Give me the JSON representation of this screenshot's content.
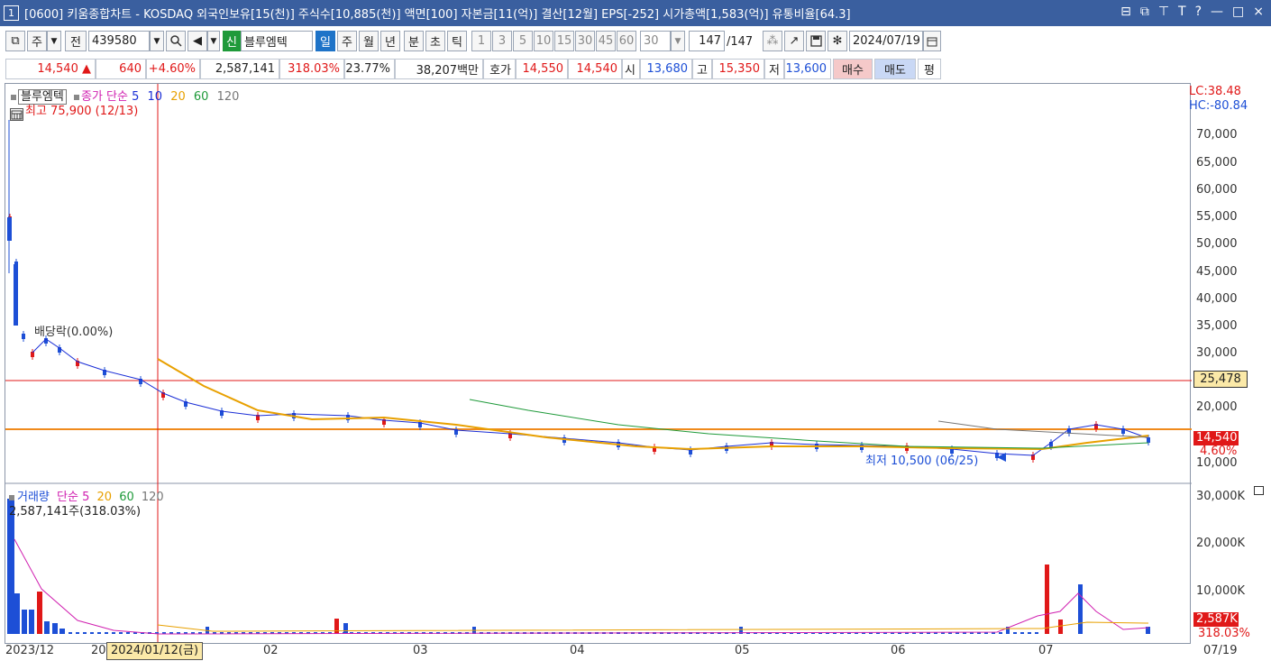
{
  "title_bar": {
    "window_number": "1",
    "text": "[0600] 키움종합차트 - KOSDAQ 외국인보유[15(천)] 주식수[10,885(천)] 액면[100] 자본금[11(억)] 결산[12월] EPS[-252] 시가총액[1,583(억)] 유통비율[64.3]",
    "controls": [
      "⊟",
      "⧉",
      "⊤",
      "T",
      "?",
      "—",
      "□",
      "×"
    ]
  },
  "toolbar": {
    "period_select": "주",
    "prev_label": "전",
    "code": "439580",
    "credit_badge": "신",
    "stock_name": "블루엠텍",
    "periods": [
      "일",
      "주",
      "월",
      "년",
      "분",
      "초",
      "틱"
    ],
    "active_period": "일",
    "intervals": [
      "1",
      "3",
      "5",
      "10",
      "15",
      "30",
      "45",
      "60"
    ],
    "interval_input": "30",
    "count_value": "147",
    "count_total": "/147",
    "date": "2024/07/19"
  },
  "quote": {
    "price": "14,540",
    "change": "640",
    "change_pct": "+4.60%",
    "volume": "2,587,141",
    "volume_ratio": "318.03%",
    "turnover": "23.77%",
    "amount": "38,207백만",
    "hoga_label": "호가",
    "ask": "14,550",
    "bid": "14,540",
    "open_label": "시",
    "open": "13,680",
    "high_label": "고",
    "high": "15,350",
    "low_label": "저",
    "low": "13,600",
    "buy_label": "매수",
    "sell_label": "매도",
    "eval_label": "평"
  },
  "price_panel": {
    "legend_name": "블루엠텍",
    "legend_type": "종가 단순",
    "ma": [
      {
        "label": "5",
        "color": "#1a2ed6"
      },
      {
        "label": "10",
        "color": "#1a2ed6"
      },
      {
        "label": "20",
        "color": "#e8a000"
      },
      {
        "label": "60",
        "color": "#1f9a3a"
      },
      {
        "label": "120",
        "color": "#777777"
      }
    ],
    "high_note": "최고 75,900 (12/13)",
    "low_note": "최저 10,500 (06/25)",
    "ex_dividend": "배당락(0.00%)",
    "lc": "LC:38.48",
    "hc": "HC:-80.84",
    "ticks": [
      "70,000",
      "65,000",
      "60,000",
      "55,000",
      "50,000",
      "45,000",
      "40,000",
      "35,000",
      "30,000",
      "20,000",
      "10,000"
    ],
    "crosshair_value": "25,478",
    "current_price": "14,540",
    "current_pct": "4.60%"
  },
  "volume_panel": {
    "legend_name": "거래량",
    "legend_type": "단순",
    "ma": [
      {
        "label": "5",
        "color": "#d020b0"
      },
      {
        "label": "20",
        "color": "#e8a000"
      },
      {
        "label": "60",
        "color": "#1f9a3a"
      },
      {
        "label": "120",
        "color": "#777777"
      }
    ],
    "current_note": "2,587,141주(318.03%)",
    "ticks": [
      "30,000K",
      "20,000K",
      "10,000K"
    ],
    "current_value": "2,587K",
    "current_pct": "318.03%"
  },
  "x_axis": {
    "labels": [
      "2023/12",
      "20",
      "02",
      "03",
      "04",
      "05",
      "06",
      "07",
      "07/19"
    ],
    "cursor_date": "2024/01/12(금)"
  },
  "colors": {
    "up": "#e01818",
    "down": "#1d4fd6",
    "titlebar": "#3a5f9f"
  }
}
